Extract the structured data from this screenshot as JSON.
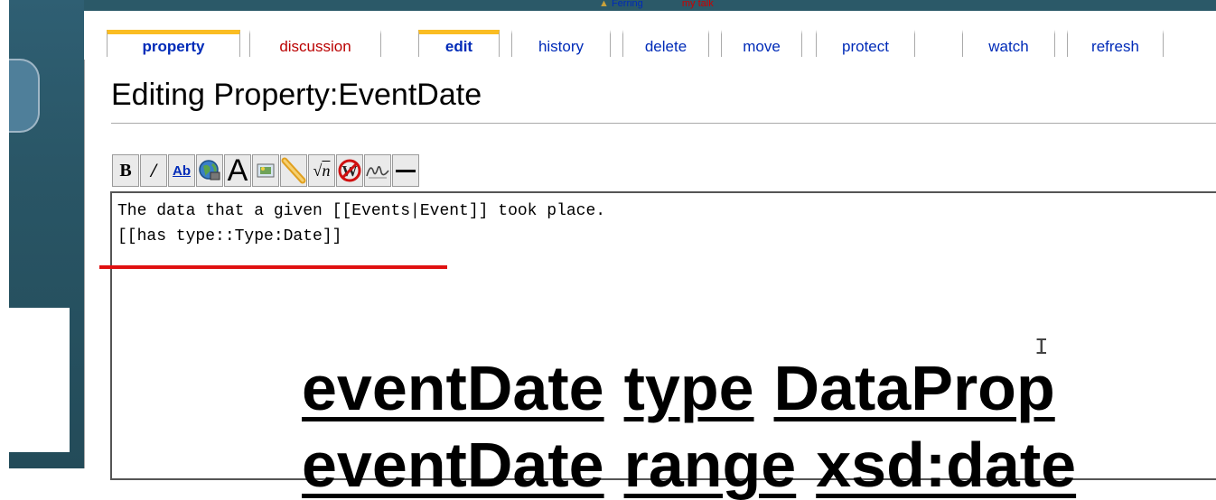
{
  "personal_bar": {
    "user_label": "Ferring",
    "talk_label": "my talk"
  },
  "tabs": [
    {
      "label": "property",
      "state": "selected"
    },
    {
      "label": "discussion",
      "state": "red"
    },
    {
      "label": "edit",
      "state": "selected"
    },
    {
      "label": "history",
      "state": "normal"
    },
    {
      "label": "delete",
      "state": "normal"
    },
    {
      "label": "move",
      "state": "normal"
    },
    {
      "label": "protect",
      "state": "normal"
    },
    {
      "label": "watch",
      "state": "normal"
    },
    {
      "label": "refresh",
      "state": "normal"
    }
  ],
  "page_title": "Editing Property:EventDate",
  "toolbar": {
    "buttons": [
      {
        "name": "bold",
        "glyph": "B"
      },
      {
        "name": "italic",
        "glyph": "I"
      },
      {
        "name": "internal-link",
        "glyph": "Ab"
      },
      {
        "name": "external-link",
        "glyph": "globe"
      },
      {
        "name": "headline",
        "glyph": "A"
      },
      {
        "name": "embedded-image",
        "glyph": "image"
      },
      {
        "name": "media-file",
        "glyph": "media"
      },
      {
        "name": "math-formula",
        "glyph": "√n"
      },
      {
        "name": "nowiki",
        "glyph": "W"
      },
      {
        "name": "signature",
        "glyph": "signature"
      },
      {
        "name": "horizontal-line",
        "glyph": "—"
      }
    ]
  },
  "editor": {
    "lines": [
      "The data that a given [[Events|Event]] took place.",
      "[[has type::Type:Date]]"
    ]
  },
  "overlay": {
    "line1": [
      "eventDate",
      "type",
      "DataProp"
    ],
    "line2": [
      "eventDate",
      "range",
      "xsd:date"
    ]
  },
  "colors": {
    "link": "#002bb8",
    "new_link": "#ba0000",
    "selected_tab_accent": "#fabd23",
    "annotation_underline": "#e01010",
    "sidebar": "#2f5f73"
  }
}
